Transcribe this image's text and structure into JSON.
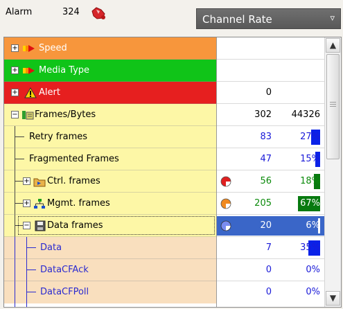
{
  "header": {
    "alarm_label": "Alarm",
    "alarm_count": "324",
    "alarm_icon": "siren-icon",
    "dropdown_label": "Channel Rate",
    "dropdown_arrow": "▿"
  },
  "colors": {
    "speed": "#f7963c",
    "media_type": "#10c418",
    "alert": "#e61f1f",
    "frames_yellow": "#fdf7a6",
    "data_children": "#f9dfbe",
    "selected_value": "#3a66c8",
    "bar_blue": "#0a22e8",
    "bar_green": "#087a10"
  },
  "rows": [
    {
      "label": "Speed",
      "icon": "red-arrow-icon",
      "expander": "+",
      "count": "",
      "pct": "",
      "pct_value": 0
    },
    {
      "label": "Media Type",
      "icon": "red-arrow-icon",
      "expander": "+",
      "count": "",
      "pct": "",
      "pct_value": 0
    },
    {
      "label": "Alert",
      "icon": "warning-icon",
      "expander": "+",
      "count": "0",
      "pct": "",
      "pct_value": 0
    },
    {
      "label": "Frames/Bytes",
      "icon": "frames-icon",
      "expander": "−",
      "count": "302",
      "pct": "44326",
      "pct_value": 0
    },
    {
      "label": "Retry frames",
      "icon": "",
      "expander": "",
      "count": "83",
      "pct": "27%",
      "pct_value": 27
    },
    {
      "label": "Fragmented Frames",
      "icon": "",
      "expander": "",
      "count": "47",
      "pct": "15%",
      "pct_value": 15
    },
    {
      "label": "Ctrl. frames",
      "icon": "control-folder-icon",
      "expander": "+",
      "count": "56",
      "pct": "18%",
      "pct_value": 18,
      "pie": "red-pie-icon"
    },
    {
      "label": "Mgmt. frames",
      "icon": "network-icon",
      "expander": "+",
      "count": "205",
      "pct": "67%",
      "pct_value": 67,
      "pie": "orange-pie-icon"
    },
    {
      "label": "Data frames",
      "icon": "disk-icon",
      "expander": "−",
      "count": "20",
      "pct": "6%",
      "pct_value": 6,
      "pie": "blue-pie-icon"
    },
    {
      "label": "Data",
      "icon": "",
      "expander": "",
      "count": "7",
      "pct": "35%",
      "pct_value": 35
    },
    {
      "label": "DataCFAck",
      "icon": "",
      "expander": "",
      "count": "0",
      "pct": "0%",
      "pct_value": 0
    },
    {
      "label": "DataCFPoll",
      "icon": "",
      "expander": "",
      "count": "0",
      "pct": "0%",
      "pct_value": 0
    }
  ],
  "scrollbar": {
    "up": "▲",
    "down": "▼"
  }
}
